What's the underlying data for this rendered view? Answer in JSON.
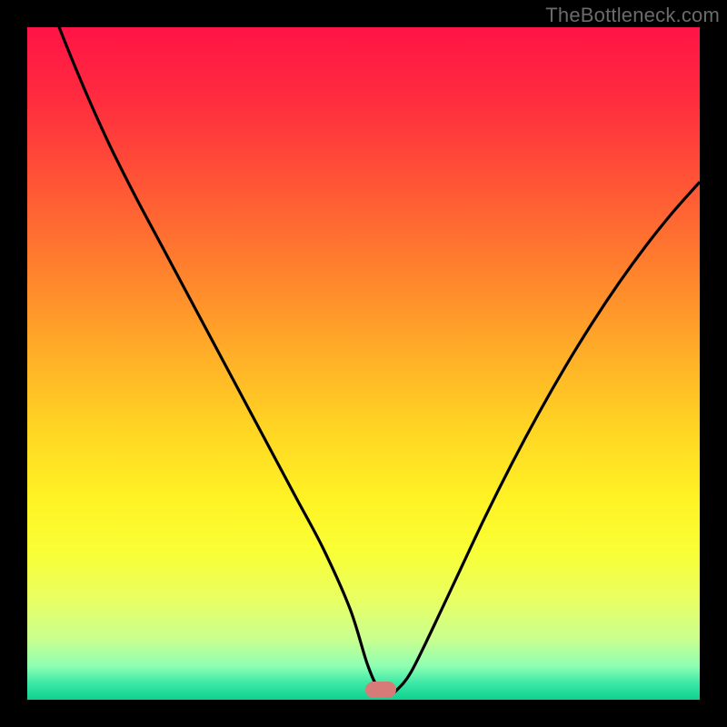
{
  "watermark": "TheBottleneck.com",
  "chart_data": {
    "type": "line",
    "title": "",
    "xlabel": "",
    "ylabel": "",
    "xlim": [
      0,
      1
    ],
    "ylim": [
      0,
      1
    ],
    "series": [
      {
        "name": "curve",
        "x": [
          0.0,
          0.04,
          0.08,
          0.12,
          0.16,
          0.2,
          0.24,
          0.28,
          0.32,
          0.36,
          0.4,
          0.44,
          0.48,
          0.505,
          0.52,
          0.535,
          0.55,
          0.57,
          0.6,
          0.64,
          0.68,
          0.72,
          0.76,
          0.8,
          0.84,
          0.88,
          0.92,
          0.96,
          1.0
        ],
        "values": [
          1.14,
          1.02,
          0.92,
          0.83,
          0.75,
          0.675,
          0.6,
          0.525,
          0.45,
          0.375,
          0.3,
          0.225,
          0.135,
          0.055,
          0.02,
          0.005,
          0.015,
          0.04,
          0.1,
          0.185,
          0.27,
          0.35,
          0.425,
          0.495,
          0.56,
          0.62,
          0.675,
          0.725,
          0.77
        ]
      }
    ],
    "marker": {
      "x": 0.525,
      "y": 0.015,
      "color": "#d87a77"
    },
    "background_gradient": {
      "stops": [
        {
          "offset": 0.0,
          "color": "#ff1446"
        },
        {
          "offset": 0.1,
          "color": "#ff2a3f"
        },
        {
          "offset": 0.2,
          "color": "#ff4a38"
        },
        {
          "offset": 0.3,
          "color": "#ff6c31"
        },
        {
          "offset": 0.4,
          "color": "#ff8f2b"
        },
        {
          "offset": 0.5,
          "color": "#ffb327"
        },
        {
          "offset": 0.6,
          "color": "#ffd623"
        },
        {
          "offset": 0.7,
          "color": "#fff224"
        },
        {
          "offset": 0.78,
          "color": "#f9ff35"
        },
        {
          "offset": 0.85,
          "color": "#e9ff62"
        },
        {
          "offset": 0.91,
          "color": "#c9ff8f"
        },
        {
          "offset": 0.95,
          "color": "#8effb3"
        },
        {
          "offset": 0.975,
          "color": "#3de8a6"
        },
        {
          "offset": 1.0,
          "color": "#0ed18f"
        }
      ]
    }
  }
}
